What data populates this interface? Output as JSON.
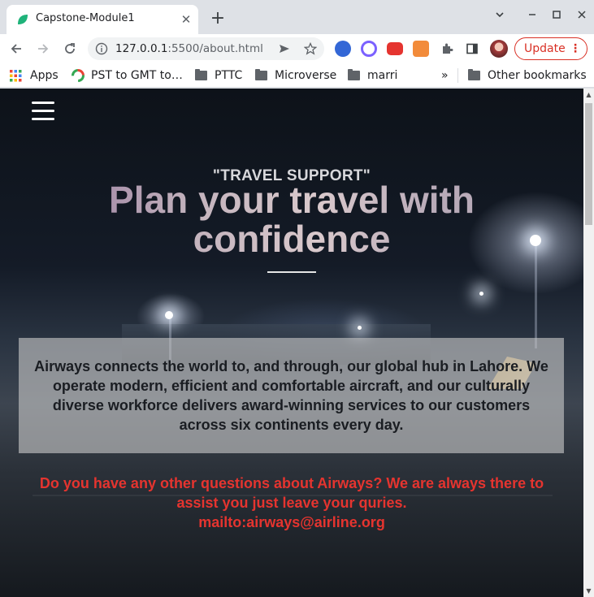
{
  "browser": {
    "tab_title": "Capstone-Module1",
    "tab_close": "✕",
    "new_tab": "+",
    "url_host": "127.0.0.1",
    "url_path": ":5500/about.html",
    "update_label": "Update",
    "update_dots": "⋮",
    "bookmarks": {
      "apps": "Apps",
      "pst": "PST to GMT to…",
      "pttc": "PTTC",
      "microverse": "Microverse",
      "marri": "marri",
      "more": "»",
      "other": "Other bookmarks"
    }
  },
  "page": {
    "eyebrow": "\"TRAVEL SUPPORT\"",
    "headline": "Plan your travel with confidence",
    "about": "Airways connects the world to, and through, our global hub in Lahore. We operate modern, efficient and comfortable aircraft, and our culturally diverse workforce delivers award-winning services to our customers across six continents every day.",
    "contact_text": "Do you have any other questions about Airways? We are always there to assist you just leave your quries.",
    "contact_link": "mailto:airways@airline.org"
  },
  "colors": {
    "accent_red": "#e5342f",
    "update_red": "#d93025",
    "tab_favicon": "#1fb37a"
  }
}
